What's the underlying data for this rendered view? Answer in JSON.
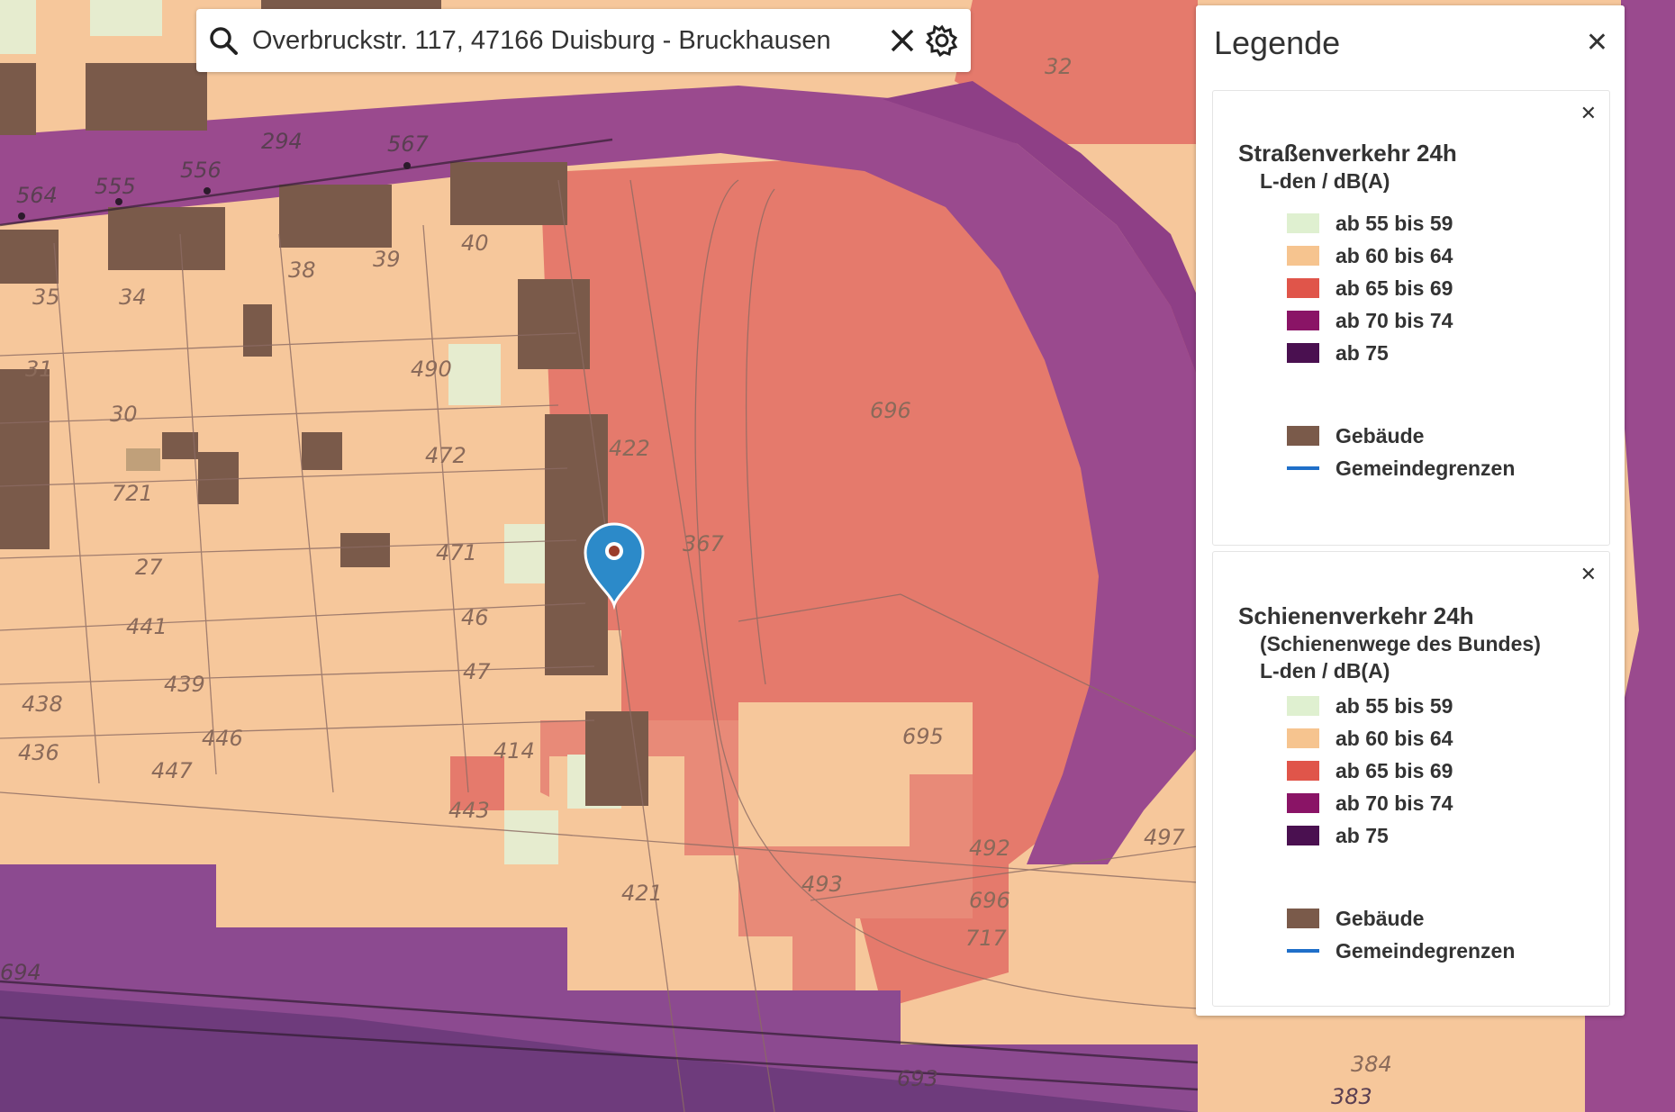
{
  "search": {
    "value": "Overbruckstr. 117, 47166 Duisburg - Bruckhausen",
    "icon": "search-icon",
    "clear_icon": "close-icon",
    "settings_icon": "gear-icon"
  },
  "legend": {
    "title": "Legende",
    "panels": [
      {
        "title": "Straßenverkehr 24h",
        "subtitle_lines": [
          "L-den / dB(A)"
        ],
        "classes": [
          {
            "label": "ab 55 bis 59",
            "color": "#dff0d0"
          },
          {
            "label": "ab 60 bis 64",
            "color": "#f6c48f"
          },
          {
            "label": "ab 65 bis 69",
            "color": "#e0554a"
          },
          {
            "label": "ab 70 bis 74",
            "color": "#8a1466"
          },
          {
            "label": "ab 75",
            "color": "#4a1050"
          }
        ],
        "extras": [
          {
            "label": "Gebäude",
            "color": "#7a5a4a",
            "kind": "box"
          },
          {
            "label": "Gemeindegrenzen",
            "color": "#1f6fc9",
            "kind": "line"
          }
        ]
      },
      {
        "title": "Schienenverkehr 24h",
        "subtitle_lines": [
          "(Schienenwege des Bundes)",
          "L-den / dB(A)"
        ],
        "classes": [
          {
            "label": "ab 55 bis 59",
            "color": "#dff0d0"
          },
          {
            "label": "ab 60 bis 64",
            "color": "#f6c48f"
          },
          {
            "label": "ab 65 bis 69",
            "color": "#e0554a"
          },
          {
            "label": "ab 70 bis 74",
            "color": "#8a1466"
          },
          {
            "label": "ab 75",
            "color": "#4a1050"
          }
        ],
        "extras": [
          {
            "label": "Gebäude",
            "color": "#7a5a4a",
            "kind": "box"
          },
          {
            "label": "Gemeindegrenzen",
            "color": "#1f6fc9",
            "kind": "line"
          }
        ]
      }
    ]
  },
  "map": {
    "plot_numbers": [
      "32",
      "294",
      "567",
      "564",
      "555",
      "556",
      "38",
      "39",
      "40",
      "35",
      "34",
      "31",
      "30",
      "490",
      "696",
      "472",
      "422",
      "721",
      "471",
      "367",
      "27",
      "46",
      "441",
      "47",
      "439",
      "438",
      "446",
      "436",
      "414",
      "447",
      "695",
      "443",
      "492",
      "497",
      "493",
      "421",
      "696",
      "717",
      "694",
      "693",
      "384",
      "383"
    ],
    "marker_icon": "location-pin-icon"
  }
}
